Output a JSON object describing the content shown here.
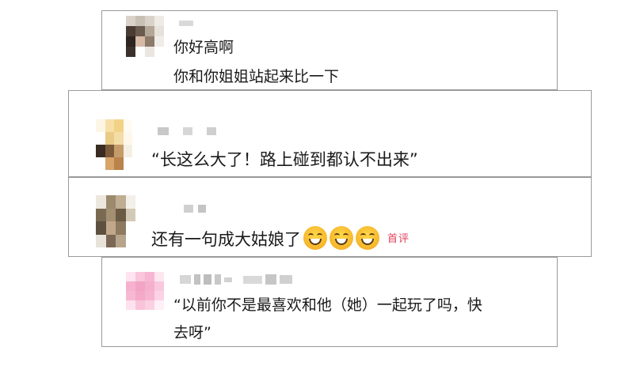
{
  "comments": [
    {
      "lines": [
        "你好高啊",
        "你和你姐姐站起来比一下"
      ]
    },
    {
      "lines": [
        "“长这么大了！路上碰到都认不出来”"
      ]
    },
    {
      "lines": [
        "还有一句成大姑娘了"
      ],
      "emojis": [
        "grinning-face",
        "grinning-face",
        "grinning-face"
      ],
      "badge": "首评"
    },
    {
      "lines": [
        "“以前你不是最喜欢和他（她）一起玩了吗，快",
        "去呀”"
      ]
    }
  ],
  "colors": {
    "badge": "#e0405a",
    "border": "#9a9a9a",
    "avatar_pink": "#f7b6d2"
  }
}
